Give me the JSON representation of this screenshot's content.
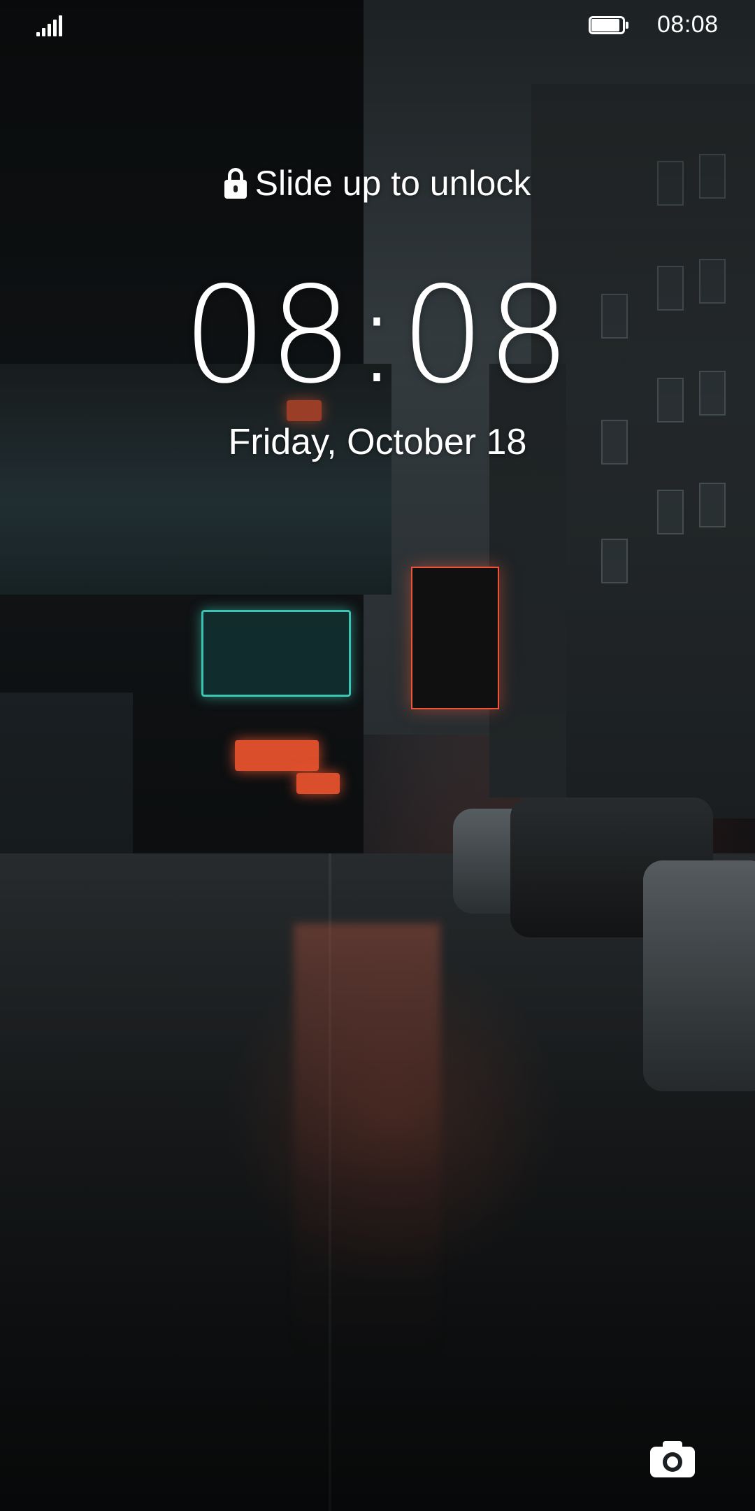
{
  "status_bar": {
    "time": "08:08",
    "signal_icon": "signal-bars-icon",
    "battery_icon": "battery-icon",
    "battery_level": 0.9
  },
  "lock_screen": {
    "unlock_hint": "Slide up to unlock",
    "unlock_icon": "lock-icon",
    "clock": "08:08",
    "date": "Friday, October 18"
  },
  "shortcuts": {
    "camera_icon": "camera-icon"
  },
  "colors": {
    "text": "#ffffff",
    "neon_red": "#e8532f",
    "neon_teal": "#3fd3c0"
  }
}
